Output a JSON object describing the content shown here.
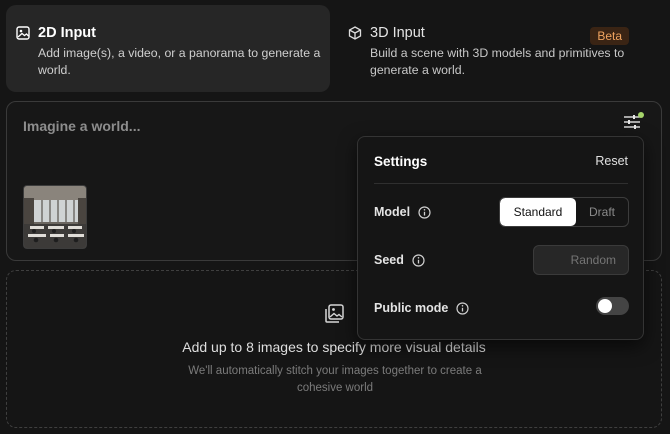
{
  "tabs": [
    {
      "title": "2D Input",
      "description": "Add image(s), a video, or a panorama to generate a world.",
      "icon": "image-icon",
      "active": true
    },
    {
      "title": "3D Input",
      "description": "Build a scene with 3D models and primitives to generate a world.",
      "icon": "cube-icon",
      "badge": "Beta",
      "active": false
    }
  ],
  "prompt": {
    "placeholder": "Imagine a world..."
  },
  "dropzone": {
    "title": "Add up to 8 images to specify more visual details",
    "subtitle": "We'll automatically stitch your images together to create a cohesive world"
  },
  "settings": {
    "title": "Settings",
    "reset_label": "Reset",
    "model_label": "Model",
    "model_options": [
      "Standard",
      "Draft"
    ],
    "model_selected": "Standard",
    "seed_label": "Seed",
    "seed_placeholder": "Random",
    "public_mode_label": "Public mode",
    "public_mode_on": false
  },
  "colors": {
    "background": "#151515",
    "beta_text": "#f0a460",
    "beta_bg": "#3a2414",
    "indicator": "#a6d46a"
  }
}
